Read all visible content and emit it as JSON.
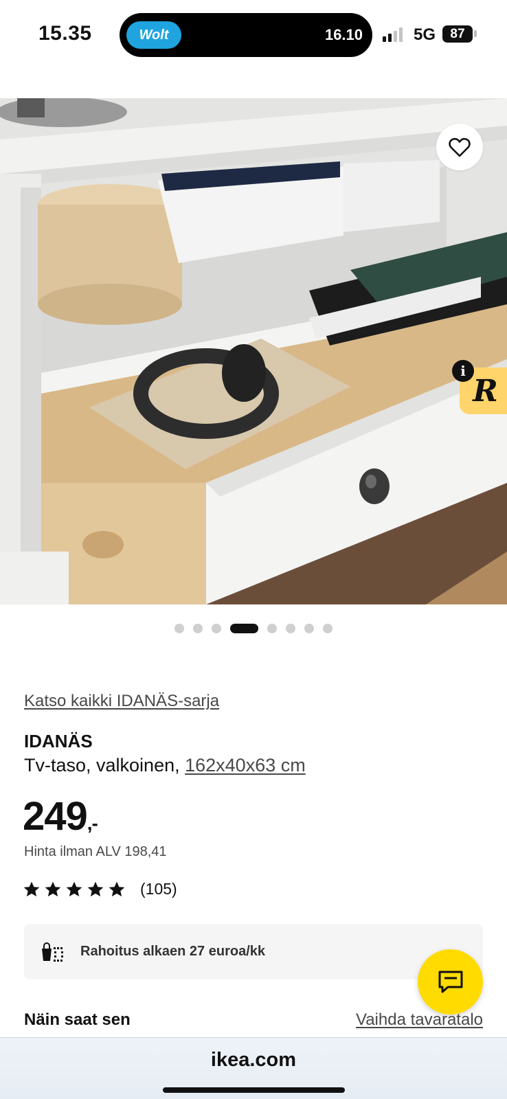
{
  "status_bar": {
    "time": "15.35",
    "island_app": "Wolt",
    "island_time": "16.10",
    "network": "5G",
    "battery": "87"
  },
  "hero": {
    "image_index": 4,
    "image_count": 8
  },
  "product": {
    "series_link": "Katso kaikki IDANÄS-sarja",
    "name": "IDANÄS",
    "description": "Tv-taso, valkoinen, ",
    "dimensions": "162x40x63 cm",
    "price": "249",
    "price_suffix": ",-",
    "vat_note": "Hinta ilman ALV 198,41",
    "rating": 5,
    "review_count": "(105)"
  },
  "finance": {
    "text": "Rahoitus alkaen 27 euroa/kk"
  },
  "delivery": {
    "title": "Näin saat sen",
    "store_link": "Vaihda tavaratalo"
  },
  "browser": {
    "url": "ikea.com"
  },
  "colors": {
    "accent_yellow": "#ffdb00",
    "wolt_blue": "#1fa4e0",
    "badge_yellow": "#ffd46b"
  }
}
